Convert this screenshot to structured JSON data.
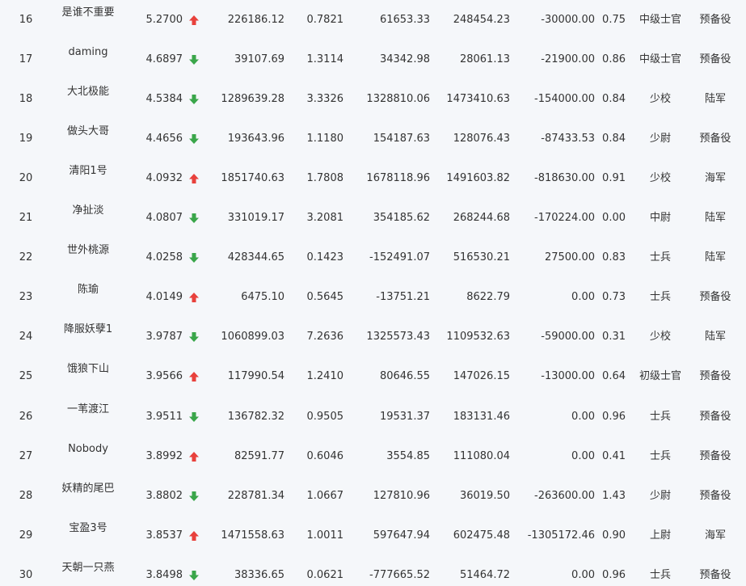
{
  "colors": {
    "background": "#f5f7fa",
    "text": "#333333",
    "arrow_up": "#e8413c",
    "arrow_down": "#3aa64a"
  },
  "rows": [
    {
      "rank": "16",
      "name": "是谁不重要",
      "score": "5.2700",
      "trend": "up",
      "v1": "226186.12",
      "v2": "0.7821",
      "v3": "61653.33",
      "v4": "248454.23",
      "v5": "-30000.00",
      "v6": "0.75",
      "rank_name": "中级士官",
      "branch": "预备役"
    },
    {
      "rank": "17",
      "name": "daming",
      "score": "4.6897",
      "trend": "down",
      "v1": "39107.69",
      "v2": "1.3114",
      "v3": "34342.98",
      "v4": "28061.13",
      "v5": "-21900.00",
      "v6": "0.86",
      "rank_name": "中级士官",
      "branch": "预备役"
    },
    {
      "rank": "18",
      "name": "大北极能",
      "score": "4.5384",
      "trend": "down",
      "v1": "1289639.28",
      "v2": "3.3326",
      "v3": "1328810.06",
      "v4": "1473410.63",
      "v5": "-154000.00",
      "v6": "0.84",
      "rank_name": "少校",
      "branch": "陆军"
    },
    {
      "rank": "19",
      "name": "做头大哥",
      "score": "4.4656",
      "trend": "down",
      "v1": "193643.96",
      "v2": "1.1180",
      "v3": "154187.63",
      "v4": "128076.43",
      "v5": "-87433.53",
      "v6": "0.84",
      "rank_name": "少尉",
      "branch": "预备役"
    },
    {
      "rank": "20",
      "name": "清阳1号",
      "score": "4.0932",
      "trend": "up",
      "v1": "1851740.63",
      "v2": "1.7808",
      "v3": "1678118.96",
      "v4": "1491603.82",
      "v5": "-818630.00",
      "v6": "0.91",
      "rank_name": "少校",
      "branch": "海军"
    },
    {
      "rank": "21",
      "name": "净扯淡",
      "score": "4.0807",
      "trend": "down",
      "v1": "331019.17",
      "v2": "3.2081",
      "v3": "354185.62",
      "v4": "268244.68",
      "v5": "-170224.00",
      "v6": "0.00",
      "rank_name": "中尉",
      "branch": "陆军"
    },
    {
      "rank": "22",
      "name": "世外桃源",
      "score": "4.0258",
      "trend": "down",
      "v1": "428344.65",
      "v2": "0.1423",
      "v3": "-152491.07",
      "v4": "516530.21",
      "v5": "27500.00",
      "v6": "0.83",
      "rank_name": "士兵",
      "branch": "陆军"
    },
    {
      "rank": "23",
      "name": "陈瑜",
      "score": "4.0149",
      "trend": "up",
      "v1": "6475.10",
      "v2": "0.5645",
      "v3": "-13751.21",
      "v4": "8622.79",
      "v5": "0.00",
      "v6": "0.73",
      "rank_name": "士兵",
      "branch": "预备役"
    },
    {
      "rank": "24",
      "name": "降服妖孽1",
      "score": "3.9787",
      "trend": "down",
      "v1": "1060899.03",
      "v2": "7.2636",
      "v3": "1325573.43",
      "v4": "1109532.63",
      "v5": "-59000.00",
      "v6": "0.31",
      "rank_name": "少校",
      "branch": "陆军"
    },
    {
      "rank": "25",
      "name": "饿狼下山",
      "score": "3.9566",
      "trend": "up",
      "v1": "117990.54",
      "v2": "1.2410",
      "v3": "80646.55",
      "v4": "147026.15",
      "v5": "-13000.00",
      "v6": "0.64",
      "rank_name": "初级士官",
      "branch": "预备役"
    },
    {
      "rank": "26",
      "name": "一苇渡江",
      "score": "3.9511",
      "trend": "down",
      "v1": "136782.32",
      "v2": "0.9505",
      "v3": "19531.37",
      "v4": "183131.46",
      "v5": "0.00",
      "v6": "0.96",
      "rank_name": "士兵",
      "branch": "预备役"
    },
    {
      "rank": "27",
      "name": "Nobody",
      "score": "3.8992",
      "trend": "up",
      "v1": "82591.77",
      "v2": "0.6046",
      "v3": "3554.85",
      "v4": "111080.04",
      "v5": "0.00",
      "v6": "0.41",
      "rank_name": "士兵",
      "branch": "预备役"
    },
    {
      "rank": "28",
      "name": "妖精的尾巴",
      "score": "3.8802",
      "trend": "down",
      "v1": "228781.34",
      "v2": "1.0667",
      "v3": "127810.96",
      "v4": "36019.50",
      "v5": "-263600.00",
      "v6": "1.43",
      "rank_name": "少尉",
      "branch": "预备役"
    },
    {
      "rank": "29",
      "name": "宝盈3号",
      "score": "3.8537",
      "trend": "up",
      "v1": "1471558.63",
      "v2": "1.0011",
      "v3": "597647.94",
      "v4": "602475.48",
      "v5": "-1305172.46",
      "v6": "0.90",
      "rank_name": "上尉",
      "branch": "海军"
    },
    {
      "rank": "30",
      "name": "天朝一只燕",
      "score": "3.8498",
      "trend": "down",
      "v1": "38336.65",
      "v2": "0.0621",
      "v3": "-777665.52",
      "v4": "51464.72",
      "v5": "0.00",
      "v6": "0.96",
      "rank_name": "士兵",
      "branch": "预备役"
    }
  ]
}
